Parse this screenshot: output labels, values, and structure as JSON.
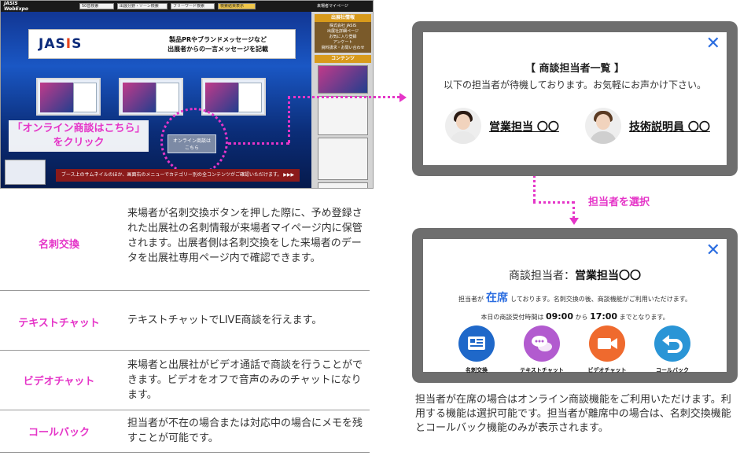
{
  "booth": {
    "logo_line1": "JASIS",
    "logo_line2": "WebExpo",
    "menus": [
      "50音検索",
      "出展分野・ゾーン検索",
      "フリーワード検索",
      "検索結果表示"
    ],
    "mypage": "来場者マイページ",
    "sidebar": {
      "heading": "出展社情報",
      "links": [
        "株式会社 JASIS",
        "出展社詳細ページ",
        "お気に入り登録",
        "アンケート",
        "資料請求・お問い合わせ"
      ],
      "contents_heading": "コンテンツ"
    },
    "banner_logo_a": "JAS",
    "banner_logo_b": "I",
    "banner_logo_c": "S",
    "banner_msg_1": "製品PRやブランドメッセージなど",
    "banner_msg_2": "出展者からの一言メッセージを記載",
    "chat_button_1": "オンライン商談は",
    "chat_button_2": "こちら",
    "bottom_message": "ブース上のサムネイルのほか、画面右のメニューでカテゴリー別の全コンテンツがご確認いただけます。 ▶▶▶",
    "callout_1": "「オンライン商談はこちら」",
    "callout_2": "をクリック"
  },
  "features": [
    {
      "name": "名刺交換",
      "desc": "来場者が名刺交換ボタンを押した際に、予め登録された出展社の名刺情報が来場者マイページ内に保管されます。出展者側は名刺交換をした来場者のデータを出展社専用ページ内で確認できます。"
    },
    {
      "name": "テキストチャット",
      "desc": "テキストチャットでLIVE商談を行えます。"
    },
    {
      "name": "ビデオチャット",
      "desc": "来場者と出展社がビデオ通話で商談を行うことができます。ビデオをオフで音声のみのチャットになります。"
    },
    {
      "name": "コールバック",
      "desc": "担当者が不在の場合または対応中の場合にメモを残すことが可能です。"
    }
  ],
  "modal1": {
    "title": "【 商談担当者一覧 】",
    "subtitle": "以下の担当者が待機しております。お気軽にお声かけ下さい。",
    "reps": [
      "営業担当 〇〇",
      "技術説明員 〇〇"
    ],
    "close": "✕"
  },
  "select_label": "担当者を選択",
  "modal2": {
    "title_prefix": "商談担当者：",
    "title_name": "営業担当〇〇",
    "status_prefix": "担当者が",
    "status": "在席",
    "status_suffix": "しております。名刺交換の後、商談機能がご利用いただけます。",
    "hours_prefix": "本日の商談受付時間は",
    "hours_from": "09:00",
    "hours_mid": "から",
    "hours_to": "17:00",
    "hours_suffix": "までとなります。",
    "buttons": [
      {
        "label": "名刺交換",
        "icon": "business-card-icon",
        "color": "#1f68c9"
      },
      {
        "label": "テキストチャット",
        "icon": "chat-bubbles-icon",
        "color": "#b25bcf"
      },
      {
        "label": "ビデオチャット",
        "icon": "video-camera-icon",
        "color": "#ef6a2e"
      },
      {
        "label": "コールバック",
        "icon": "callback-arrow-icon",
        "color": "#2a95d6"
      }
    ],
    "close": "✕"
  },
  "note": "担当者が在席の場合はオンライン商談機能をご利用いただけます。利用する機能は選択可能です。担当者が離席中の場合は、名刺交換機能とコールバック機能のみが表示されます。"
}
